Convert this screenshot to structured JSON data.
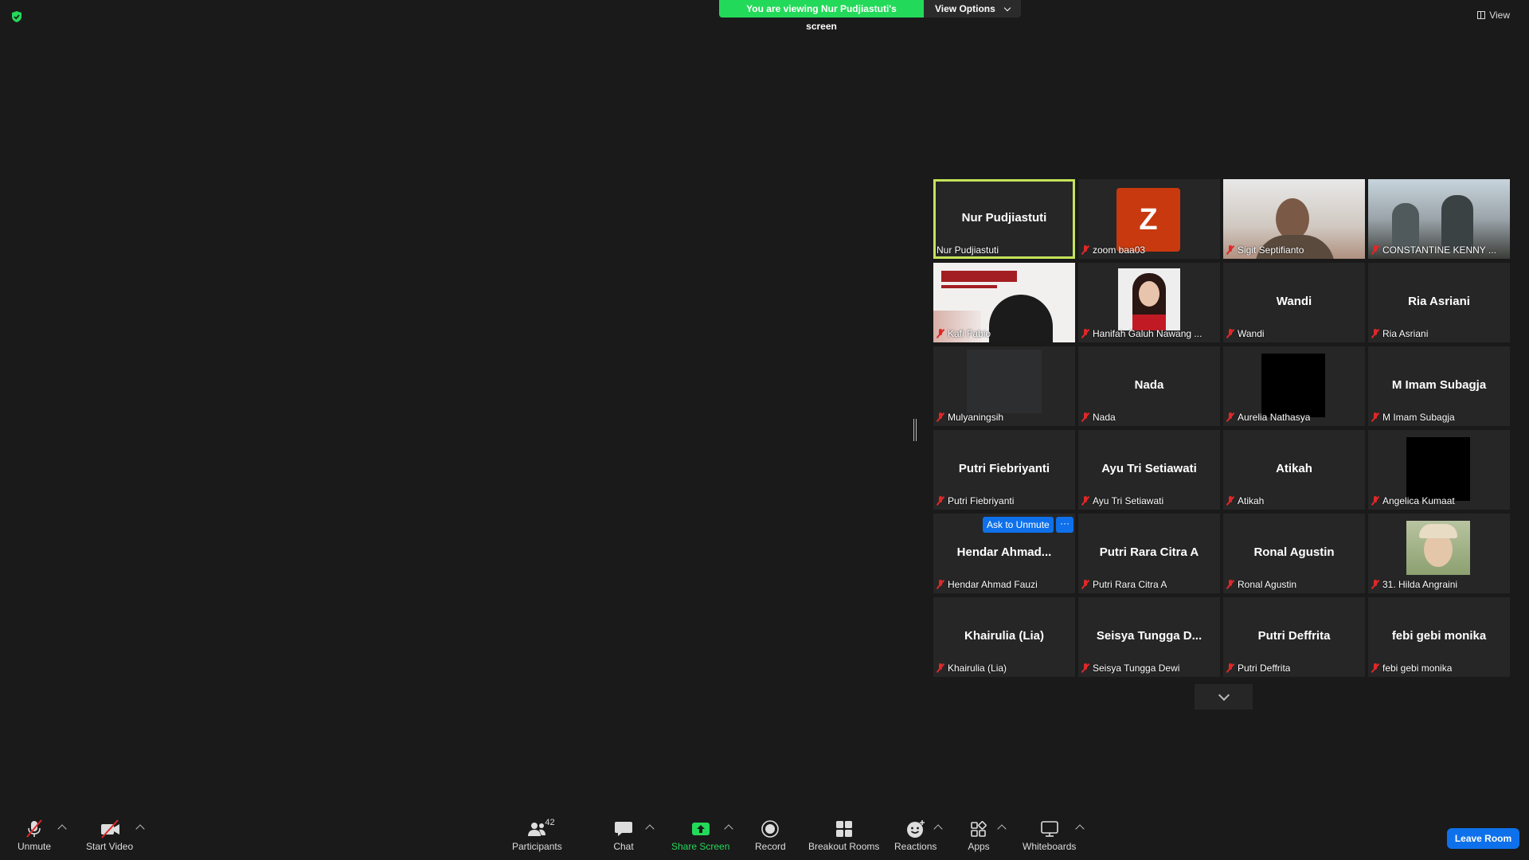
{
  "banner": {
    "viewing_text": "You are viewing Nur Pudjiastuti's screen",
    "view_options": "View Options"
  },
  "view_button": "View",
  "tiles": [
    {
      "big": "Nur Pudjiastuti",
      "label": "Nur Pudjiastuti",
      "muted": false
    },
    {
      "label": "zoom baa03",
      "avatar": "Z",
      "muted": true
    },
    {
      "label": "Sigit Septifianto",
      "muted": true
    },
    {
      "label": "CONSTANTINE KENNY ...",
      "muted": true
    },
    {
      "label": "Kafi Fabio",
      "muted": true
    },
    {
      "label": "Hanifah Galuh Nawang ...",
      "muted": true
    },
    {
      "big": "Wandi",
      "label": "Wandi",
      "muted": true
    },
    {
      "big": "Ria Asriani",
      "label": "Ria Asriani",
      "muted": true
    },
    {
      "label": "Mulyaningsih",
      "muted": true
    },
    {
      "big": "Nada",
      "label": "Nada",
      "muted": true
    },
    {
      "label": "Aurelia Nathasya",
      "muted": true
    },
    {
      "big": "M Imam Subagja",
      "label": "M Imam Subagja",
      "muted": true
    },
    {
      "big": "Putri Fiebriyanti",
      "label": "Putri Fiebriyanti",
      "muted": true
    },
    {
      "big": "Ayu Tri Setiawati",
      "label": "Ayu Tri Setiawati",
      "muted": true
    },
    {
      "big": "Atikah",
      "label": "Atikah",
      "muted": true
    },
    {
      "label": "Angelica Kumaat",
      "muted": true
    },
    {
      "big": "Hendar  Ahmad...",
      "label": "Hendar Ahmad Fauzi",
      "muted": true
    },
    {
      "big": "Putri Rara Citra A",
      "label": "Putri Rara Citra A",
      "muted": true
    },
    {
      "big": "Ronal Agustin",
      "label": "Ronal Agustin",
      "muted": true
    },
    {
      "label": "31. Hilda Angraini",
      "muted": true
    },
    {
      "big": "Khairulia (Lia)",
      "label": "Khairulia (Lia)",
      "muted": true
    },
    {
      "big": "Seisya  Tungga  D...",
      "label": "Seisya Tungga Dewi",
      "muted": true
    },
    {
      "big": "Putri Deffrita",
      "label": "Putri Deffrita",
      "muted": true
    },
    {
      "big": "febi gebi monika",
      "label": "febi gebi monika",
      "muted": true
    }
  ],
  "hover": {
    "ask_unmute": "Ask to Unmute",
    "more": "···"
  },
  "toolbar": {
    "unmute": "Unmute",
    "start_video": "Start Video",
    "participants": "Participants",
    "participants_count": "42",
    "chat": "Chat",
    "share_screen": "Share Screen",
    "record": "Record",
    "breakout_rooms": "Breakout Rooms",
    "reactions": "Reactions",
    "apps": "Apps",
    "whiteboards": "Whiteboards",
    "leave_room": "Leave Room"
  },
  "colors": {
    "accent_green": "#23d959",
    "active_border": "#c5e35a",
    "blue": "#0e71eb",
    "muted_red": "#e02828"
  }
}
